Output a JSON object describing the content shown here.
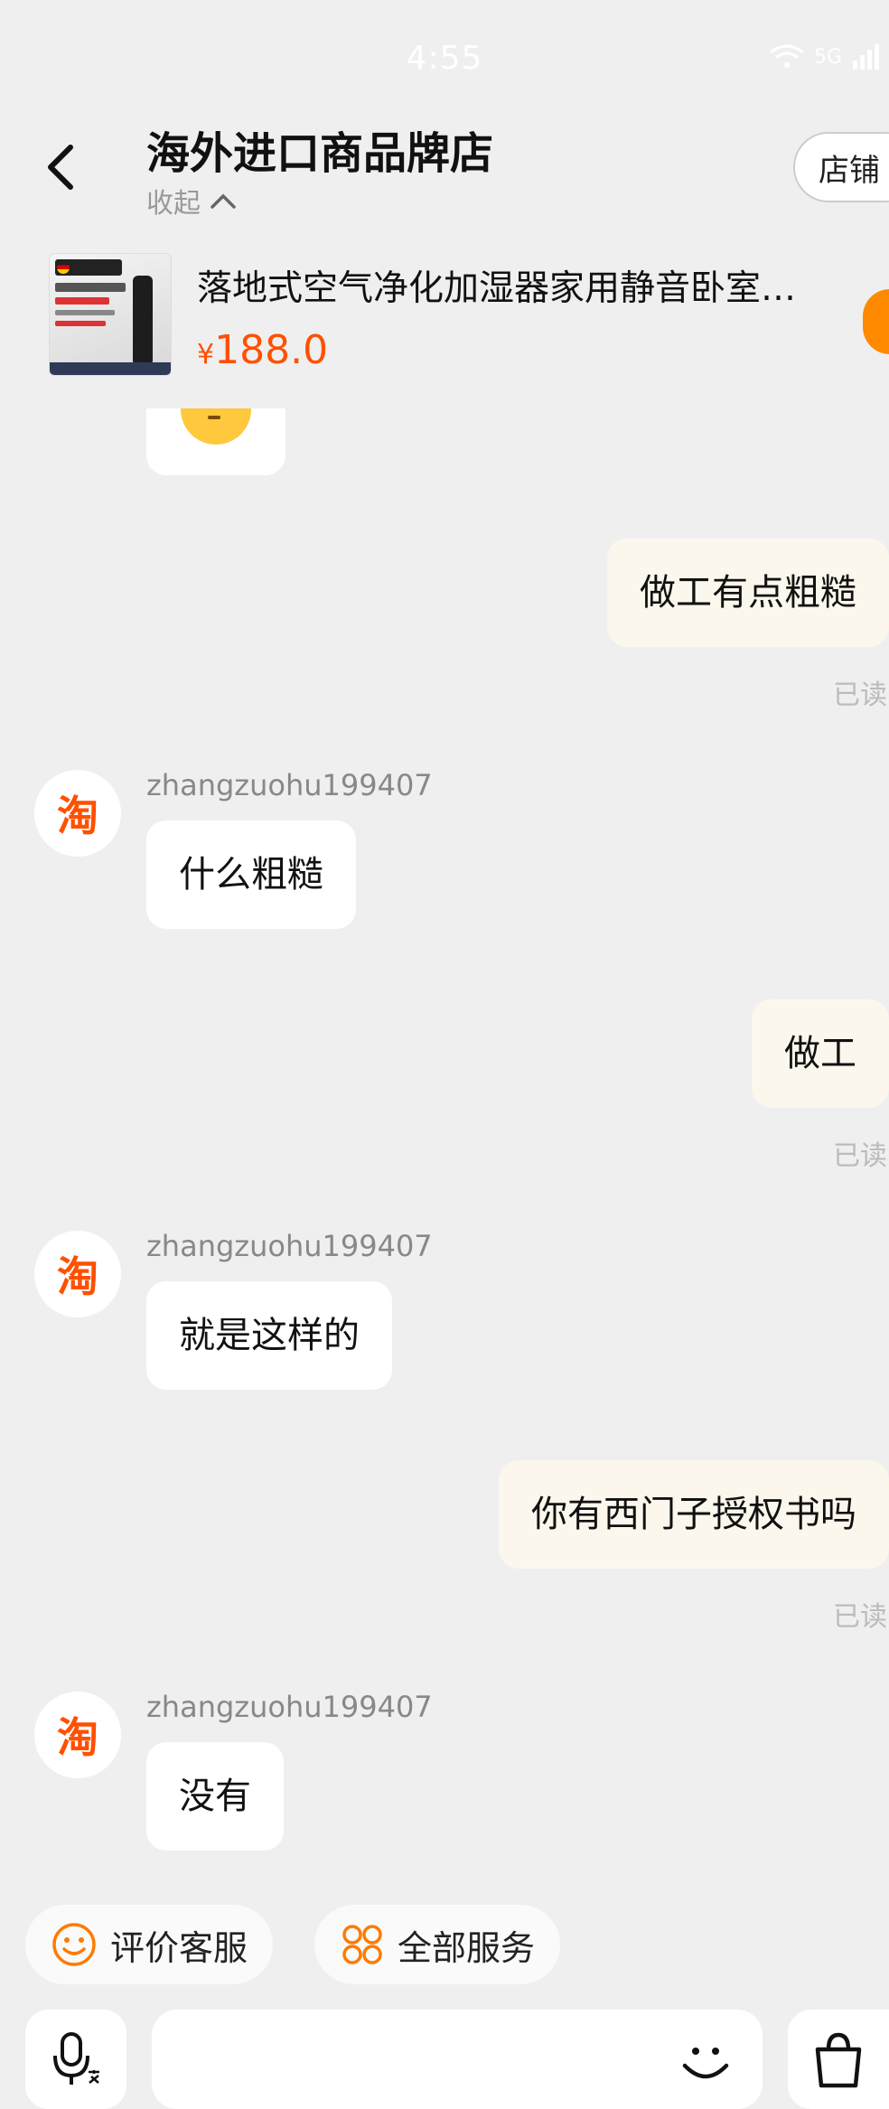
{
  "status_bar": {
    "time": "4:55",
    "network": "5G"
  },
  "header": {
    "title": "海外进口商品牌店",
    "collapse_label": "收起",
    "shop_button": "店铺"
  },
  "product": {
    "title": "落地式空气净化加湿器家用静音卧室大雾量",
    "currency": "¥",
    "price": "188.0"
  },
  "messages": [
    {
      "direction": "out",
      "text": "做工有点粗糙",
      "status": "已读"
    },
    {
      "direction": "in",
      "sender": "zhangzuohu199407",
      "avatar": "淘",
      "text": "什么粗糙"
    },
    {
      "direction": "out",
      "text": "做工",
      "status": "已读"
    },
    {
      "direction": "in",
      "sender": "zhangzuohu199407",
      "avatar": "淘",
      "text": "就是这样的"
    },
    {
      "direction": "out",
      "text": "你有西门子授权书吗",
      "status": "已读"
    },
    {
      "direction": "in",
      "sender": "zhangzuohu199407",
      "avatar": "淘",
      "text": "没有"
    }
  ],
  "quick_actions": [
    {
      "label": "评价客服",
      "icon": "smiley-icon"
    },
    {
      "label": "全部服务",
      "icon": "services-grid-icon"
    }
  ],
  "input_bar": {
    "placeholder": ""
  },
  "colors": {
    "brand_orange": "#ff5000",
    "outgoing_bubble": "#fcf7ec",
    "background": "#efefef"
  }
}
